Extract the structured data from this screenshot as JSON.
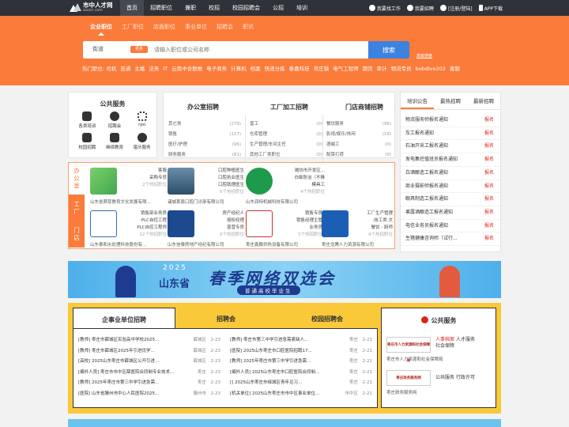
{
  "site": {
    "logo_title": "市中人才网",
    "logo_sub": "zzszrc.com"
  },
  "nav": [
    "首页",
    "招聘职位",
    "兼职",
    "校招",
    "校园招聘会",
    "公招",
    "培训"
  ],
  "top_right": {
    "find_job": "我要找工作",
    "post_job": "我要招聘",
    "login": "[注册/登陆]",
    "app": "APP下载"
  },
  "search": {
    "tabs": [
      "企业职位",
      "工厂职位",
      "店面职位",
      "事业单位",
      "招聘会",
      "职讯"
    ],
    "city": "街道",
    "city_badge": "更多",
    "placeholder": "请输入职位或公司名称",
    "button": "搜索",
    "advanced": "高级搜索"
  },
  "hot": {
    "label": "热门职位:",
    "items": [
      "司机",
      "普通",
      "主播",
      "法务",
      "IT",
      "云南中合数推",
      "电子商务",
      "计算机",
      "档案",
      "快递分拣",
      "泰嘉科技",
      "常庄镇",
      "电气工程师",
      "期货",
      "审计",
      "物流专员",
      "bobdive202",
      "客服"
    ]
  },
  "public_service": {
    "title": "公共服务",
    "items": [
      "各类培训",
      "招聘会",
      "rpo",
      "校园招聘",
      "继续教育",
      "猎头服务"
    ]
  },
  "office": {
    "title": "办公室招聘",
    "rows": [
      {
        "name": "其它类",
        "count": "(279)"
      },
      {
        "name": "销售",
        "count": "(117)"
      },
      {
        "name": "医疗/护理",
        "count": "(96)"
      },
      {
        "name": "财务服务",
        "count": "(81)"
      }
    ]
  },
  "factory": {
    "title": "工厂加工招聘",
    "rows": [
      {
        "name": "普工",
        "count": "(0)"
      },
      {
        "name": "仓库管理",
        "count": "(0)"
      },
      {
        "name": "生产管理/车间主任",
        "count": "(0)"
      },
      {
        "name": "其他工厂类职位",
        "count": "(0)"
      }
    ]
  },
  "shop": {
    "title": "门店商铺招聘",
    "rows": [
      {
        "name": "餐饮服务",
        "count": "(96)"
      },
      {
        "name": "影视/娱乐/休闲",
        "count": "(18)"
      },
      {
        "name": "酒碱工",
        "count": "(0)"
      },
      {
        "name": "配菜打荷",
        "count": "(0)"
      }
    ]
  },
  "notice": {
    "tabs": [
      "培训公告",
      "最热招聘",
      "最新招聘"
    ],
    "tag": "报名",
    "items": [
      "物流服务师报名通知",
      "车工报名通知",
      "石油开采工报名通知",
      "发电集控值班员报名通知",
      "白酒酿造工报名通知",
      "商业摄影师报名通知",
      "眼具制造工报名通知",
      "果露酒酿造工报名通知",
      "电信业务员报名通知",
      "生猪健康咨询师（试行..."
    ]
  },
  "featured": {
    "labels": [
      "办公室",
      "工厂",
      "门店"
    ],
    "cards": [
      {
        "l1": "客服",
        "l2": "采购专员",
        "meta": "2个热招职位",
        "company": "山东省萌芽教育文化发展有限..."
      },
      {
        "l1": "口腔种植医生",
        "l2": "口腔执业医生",
        "l3": "口腔助理医生",
        "meta": "6个热招职位",
        "company": "诸城莱恩口腔门诊部有限公司"
      },
      {
        "l1": "潍坊市开发区...",
        "l2": "白蚁防治（不推",
        "l3": "模具工",
        "meta": "4个热招职位",
        "company": "山东润特机械科技有限公司"
      },
      {
        "l1": "销售部业务员",
        "l2": "PLC自控工程",
        "l3": "PLC自控工程师",
        "meta": "22个热招职位",
        "company": "山东泰和水处理科技股份有..."
      },
      {
        "l1": "房产经纪人",
        "l2": "授权经理",
        "l3": "普营专员",
        "meta": "6个热招职位",
        "company": "山东信泰房地产经纪有限公司"
      },
      {
        "l1": "销售专员",
        "l2": "销售经理主管",
        "l3": "业务员",
        "meta": "5个热招职位",
        "company": "枣庄鑫鹏供热设备有限公司"
      },
      {
        "l1": "工厂生产管理",
        "l2": "-技工类·文",
        "l3": "餐饮 - 厨师",
        "meta": "4个热招职位",
        "company": "枣庄龙腾人力资源有限公司"
      }
    ]
  },
  "banner": {
    "year": "2025",
    "province": "山东省",
    "main": "春季网络双选会",
    "sub": "普通高校毕业生"
  },
  "bottom": {
    "tabs": [
      "企事业单位招聘",
      "招聘会",
      "校园招聘会"
    ],
    "left_jobs": [
      {
        "t": "[教师] 枣庄市薛城区实验高中学校2025...",
        "c": "薛城区",
        "d": "2-23"
      },
      {
        "t": "[教师] 枣庄市薛城区2025年引进优学...",
        "c": "薛城区",
        "d": "2-23"
      },
      {
        "t": "[高校] 2025山东枣庄市薛城区公开引进...",
        "c": "薛城区",
        "d": "2-23"
      },
      {
        "t": "[编外人员] 枣庄市市中区薛医院合同制专业技术...",
        "c": "枣庄",
        "d": "2-23"
      },
      {
        "t": "[教师] 2025年枣庄市第三中学引进急需...",
        "c": "枣庄",
        "d": "2-23"
      },
      {
        "t": "[医院] 山东省滕州市中心人民医院2025...",
        "c": "滕州市",
        "d": "2-23"
      }
    ],
    "right_jobs": [
      {
        "t": "[教师] 枣庄市第三中学引进急需紧缺人...",
        "c": "枣庄",
        "d": "2-21"
      },
      {
        "t": "[医院] 2025山东枣庄市口腔医院招聘17...",
        "c": "枣庄",
        "d": "2-21"
      },
      {
        "t": "[教师] 2025年枣庄市第三中学引进急需...",
        "c": "枣庄",
        "d": "2-21"
      },
      {
        "t": "[编外人员] 2025山东枣庄市口腔医院合同制...",
        "c": "枣庄",
        "d": "2-21"
      },
      {
        "t": "[] 2025山东枣庄市峄城区青年见习...",
        "c": "枣庄",
        "d": "2-21"
      },
      {
        "t": "[机关单位] 2025山东枣庄市市中区事业单位...",
        "c": "市中区",
        "d": "2-21"
      }
    ],
    "public": {
      "title": "公共服务",
      "items": [
        {
          "logo": "枣庄市人力资源和社会保障局",
          "links": [
            "人事档案",
            "人才服务",
            "社会保障"
          ],
          "name": "枣庄市人力资源和社会保障局"
        },
        {
          "logo": "枣庄政务服务网",
          "links": [
            "公共服务",
            "行政许可"
          ],
          "name": "枣庄政务服务网"
        }
      ]
    }
  },
  "colors": {
    "primary": "#fb7b3a",
    "nav_bg": "#2f3238",
    "accent_blue": "#3d82e0",
    "yellow": "#f9c93a"
  }
}
